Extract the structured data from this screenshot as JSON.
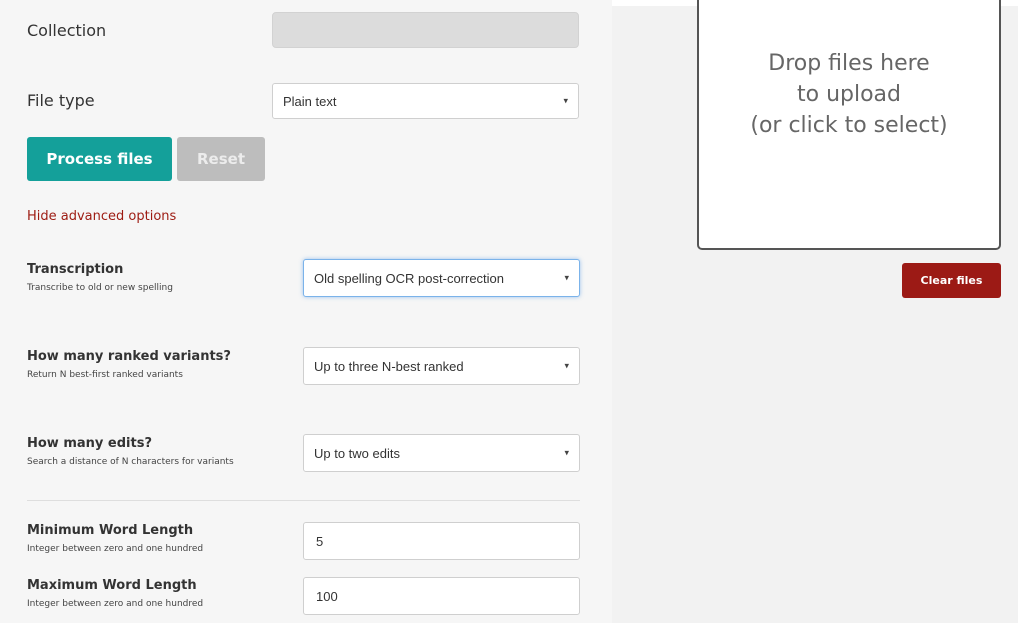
{
  "form": {
    "collection_label": "Collection",
    "collection_value": "",
    "filetype_label": "File type",
    "filetype_value": "Plain text",
    "process_label": "Process files",
    "reset_label": "Reset",
    "advanced_toggle": "Hide advanced options"
  },
  "advanced": {
    "transcription": {
      "title": "Transcription",
      "help": "Transcribe to old or new spelling",
      "value": "Old spelling OCR post-correction"
    },
    "ranked": {
      "title": "How many ranked variants?",
      "help": "Return N best-first ranked variants",
      "value": "Up to three N-best ranked"
    },
    "edits": {
      "title": "How many edits?",
      "help": "Search a distance of N characters for variants",
      "value": "Up to two edits"
    },
    "min_length": {
      "title": "Minimum Word Length",
      "help": "Integer between zero and one hundred",
      "value": "5"
    },
    "max_length": {
      "title": "Maximum Word Length",
      "help": "Integer between zero and one hundred",
      "value": "100"
    }
  },
  "dropzone": {
    "line1": "Drop files here",
    "line2": "to upload",
    "line3": "(or click to select)"
  },
  "clear_label": "Clear files",
  "icons": {
    "select_caret": "dropdown-caret-icon"
  },
  "colors": {
    "process": "#14a09a",
    "reset": "#bdbdbd",
    "clear": "#9c1a15",
    "link": "#9d1b12"
  }
}
